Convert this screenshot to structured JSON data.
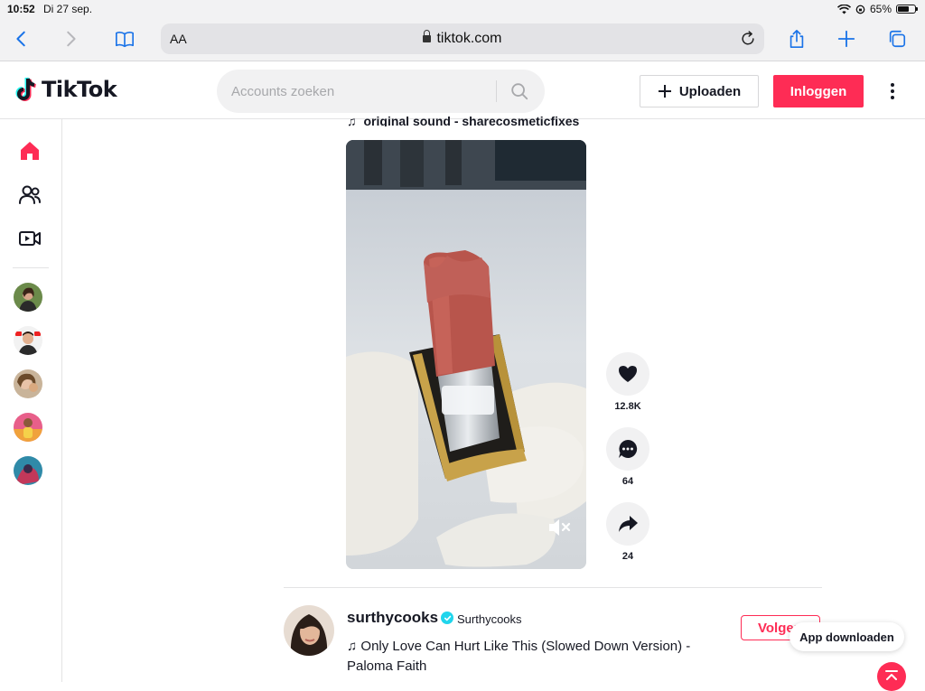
{
  "status_bar": {
    "time": "10:52",
    "date": "Di 27 sep.",
    "battery": "65%"
  },
  "safari": {
    "text_size_label": "AA",
    "url": "tiktok.com"
  },
  "header": {
    "logo_text": "TikTok",
    "search_placeholder": "Accounts zoeken",
    "upload_label": "Uploaden",
    "login_label": "Inloggen"
  },
  "sidebar": {
    "nav": [
      "home-icon",
      "following-icon",
      "live-icon"
    ],
    "avatars": 5
  },
  "feed": {
    "current_video": {
      "sound": "original sound - sharecosmeticfixes",
      "likes": "12.8K",
      "comments": "64",
      "shares": "24"
    },
    "next_post": {
      "username": "surthycooks",
      "nickname": "Surthycooks",
      "song": "Only Love Can Hurt Like This (Slowed Down Version) - Paloma Faith",
      "follow_label": "Volgen"
    }
  },
  "app_download_label": "App downloaden",
  "colors": {
    "brand": "#fe2c55",
    "safari_accent": "#1a73e8",
    "verified": "#20d5ec"
  }
}
